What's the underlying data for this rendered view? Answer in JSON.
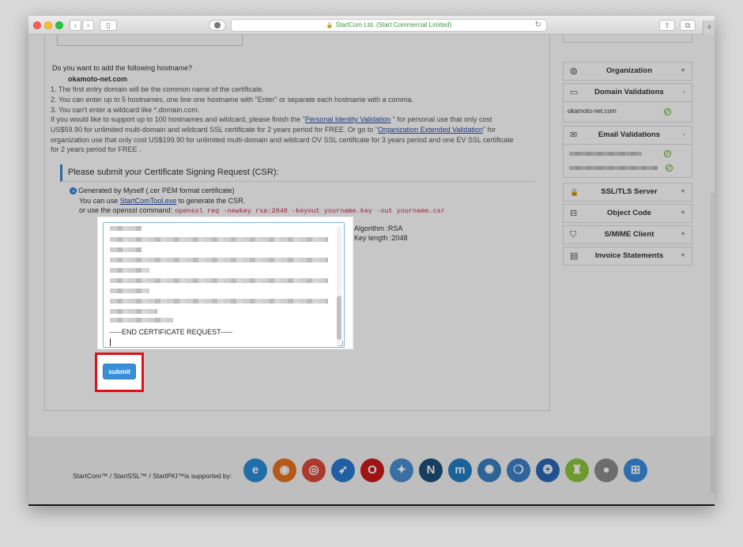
{
  "browser": {
    "url_text": "StartCom Ltd. (Start Commercial Limited)",
    "back_glyph": "‹",
    "forward_glyph": "›",
    "sidebar_glyph": "▯",
    "share_glyph": "⇧",
    "tabs_glyph": "⧉",
    "new_tab_glyph": "+",
    "lock_glyph": "🔒",
    "reload_glyph": "↻"
  },
  "hostname_section": {
    "question": "Do you want to add the following hostname?",
    "hostname": "okamoto-net.com",
    "rules": [
      "1. The first entry domain will be the common name of the certificate.",
      "2. You can enter up to 5 hostnames, one line one hostname with \"Enter\" or separate each hostname with a comma.",
      "3. You can't enter a wildcard like *.domain.com."
    ],
    "support_line1_pre": "If you would like to support up to 100 hostnames and wildcard, please finish the \"",
    "support_link1": "Personal Identity Validation",
    "support_line1_post": " \" for personal use that only cost",
    "support_line2_pre": "US$59.90 for unlimited multi-domain and wildcard SSL certificate for 2 years period for FREE. Or go to \"",
    "support_link2": "Organization Extended Validation",
    "support_line2_post": "\" for",
    "support_line3": "organization use that only cost US$199.90 for unlimited multi-domain and wildcard OV SSL certificate for 3 years period and one EV SSL certificate",
    "support_line4": "for 2 years period for FREE ."
  },
  "csr": {
    "heading": "Please submit your Certificate Signing Request (CSR):",
    "generated_label": "Generated by Myself   (.cer PEM format certificate)",
    "use_tool_pre": "You can use ",
    "use_tool_link": "StartComTool.exe",
    "use_tool_post": " to generate the CSR.",
    "openssl_pre": "or use the openssl command:",
    "openssl_cmd": "openssl req -newkey rsa:2048 -keyout yourname.key -out yourname.csr",
    "end_line": "-----END CERTIFICATE REQUEST-----",
    "algorithm": "Algorithm :RSA",
    "key_length": "Key length :2048",
    "submit_label": "submit"
  },
  "sidebar": {
    "items": [
      {
        "label": "Organization",
        "toggle": "+",
        "icon": "globe-icon",
        "glyph": "◍"
      },
      {
        "label": "Domain Validations",
        "toggle": "-",
        "icon": "www-icon",
        "glyph": "▭"
      },
      {
        "label": "Email Validations",
        "toggle": "-",
        "icon": "envelope-icon",
        "glyph": "✉"
      },
      {
        "label": "SSL/TLS Server",
        "toggle": "+",
        "icon": "lock-icon",
        "glyph": "🔒"
      },
      {
        "label": "Object Code",
        "toggle": "+",
        "icon": "code-lock-icon",
        "glyph": "⊟"
      },
      {
        "label": "S/MIME Client",
        "toggle": "+",
        "icon": "shield-check-icon",
        "glyph": "⛉"
      },
      {
        "label": "Invoice Statements",
        "toggle": "+",
        "icon": "invoice-icon",
        "glyph": "▤"
      }
    ],
    "domain_entry": "okamoto-net.com",
    "check_glyph": "✓"
  },
  "footer": {
    "supported_by": "StartCom™ / StartSSL™ / StartPKI™is supported by:",
    "browsers": [
      {
        "icon": "ie-icon",
        "glyph": "e",
        "color": "#2a8fd8"
      },
      {
        "icon": "firefox-icon",
        "glyph": "◉",
        "color": "#e8731f"
      },
      {
        "icon": "chrome-icon",
        "glyph": "◎",
        "color": "#dd4b39"
      },
      {
        "icon": "safari-icon",
        "glyph": "➶",
        "color": "#2a7ad0"
      },
      {
        "icon": "opera-icon",
        "glyph": "O",
        "color": "#cc1a1a"
      },
      {
        "icon": "konqueror-icon",
        "glyph": "✦",
        "color": "#4a8fd0"
      },
      {
        "icon": "netscape-icon",
        "glyph": "N",
        "color": "#1e4f7a"
      },
      {
        "icon": "maxthon-icon",
        "glyph": "m",
        "color": "#1f7fc4"
      },
      {
        "icon": "seamonkey-icon",
        "glyph": "✺",
        "color": "#3a7fc0"
      },
      {
        "icon": "flock-icon",
        "glyph": "❍",
        "color": "#3d80c8"
      },
      {
        "icon": "camino-icon",
        "glyph": "❂",
        "color": "#2b6ab8"
      },
      {
        "icon": "android-icon",
        "glyph": "♜",
        "color": "#8cc43c"
      },
      {
        "icon": "apple-icon",
        "glyph": "●",
        "color": "#8c8c8c"
      },
      {
        "icon": "windows-icon",
        "glyph": "⊞",
        "color": "#3a8ee0"
      }
    ]
  }
}
